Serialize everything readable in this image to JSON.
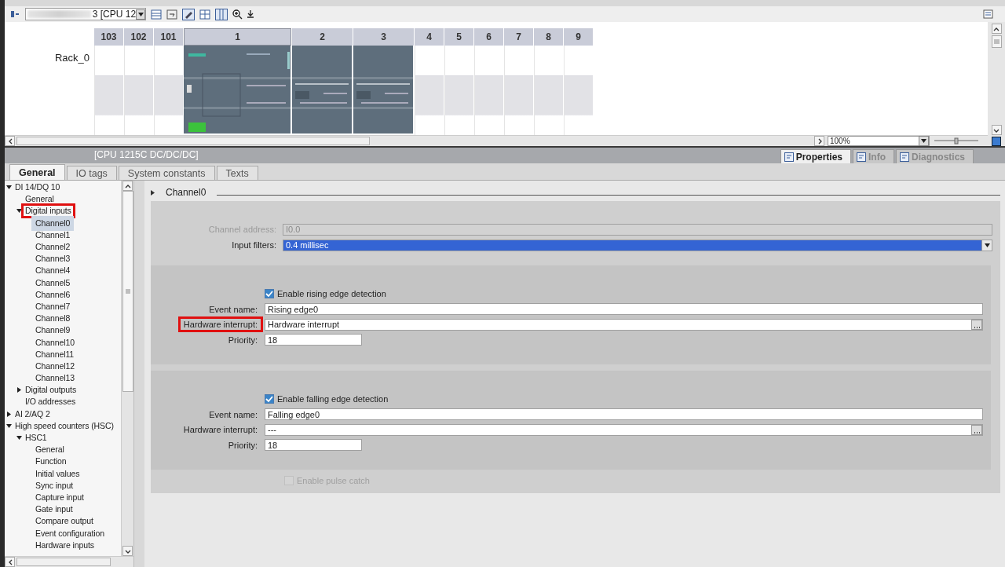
{
  "toolbar": {
    "device_dropdown": "3 [CPU 12",
    "zoom": "100%"
  },
  "rack": {
    "label": "Rack_0",
    "slots": [
      {
        "label": "103",
        "kind": "empty"
      },
      {
        "label": "102",
        "kind": "empty"
      },
      {
        "label": "101",
        "kind": "empty"
      },
      {
        "label": "1",
        "kind": "cpu"
      },
      {
        "label": "2",
        "kind": "module"
      },
      {
        "label": "3",
        "kind": "module"
      },
      {
        "label": "4",
        "kind": "empty"
      },
      {
        "label": "5",
        "kind": "empty"
      },
      {
        "label": "6",
        "kind": "empty"
      },
      {
        "label": "7",
        "kind": "empty"
      },
      {
        "label": "8",
        "kind": "empty"
      },
      {
        "label": "9",
        "kind": "empty"
      }
    ]
  },
  "properties_header": {
    "title": "[CPU 1215C DC/DC/DC]",
    "tabs": [
      {
        "label": "Properties",
        "selected": true
      },
      {
        "label": "Info",
        "selected": false
      },
      {
        "label": "Diagnostics",
        "selected": false
      }
    ]
  },
  "tabs": [
    {
      "label": "General",
      "selected": true
    },
    {
      "label": "IO tags",
      "selected": false
    },
    {
      "label": "System constants",
      "selected": false
    },
    {
      "label": "Texts",
      "selected": false
    }
  ],
  "tree": [
    {
      "label": "DI 14/DQ 10",
      "selected": false,
      "highlighted": false,
      "expanded": true,
      "children": [
        {
          "label": "General",
          "selected": false,
          "highlighted": false
        },
        {
          "label": "Digital inputs",
          "selected": false,
          "highlighted": true,
          "expanded": true,
          "children": [
            {
              "label": "Channel0",
              "selected": true,
              "highlighted": false
            },
            {
              "label": "Channel1",
              "selected": false,
              "highlighted": false
            },
            {
              "label": "Channel2",
              "selected": false,
              "highlighted": false
            },
            {
              "label": "Channel3",
              "selected": false,
              "highlighted": false
            },
            {
              "label": "Channel4",
              "selected": false,
              "highlighted": false
            },
            {
              "label": "Channel5",
              "selected": false,
              "highlighted": false
            },
            {
              "label": "Channel6",
              "selected": false,
              "highlighted": false
            },
            {
              "label": "Channel7",
              "selected": false,
              "highlighted": false
            },
            {
              "label": "Channel8",
              "selected": false,
              "highlighted": false
            },
            {
              "label": "Channel9",
              "selected": false,
              "highlighted": false
            },
            {
              "label": "Channel10",
              "selected": false,
              "highlighted": false
            },
            {
              "label": "Channel11",
              "selected": false,
              "highlighted": false
            },
            {
              "label": "Channel12",
              "selected": false,
              "highlighted": false
            },
            {
              "label": "Channel13",
              "selected": false,
              "highlighted": false
            }
          ]
        },
        {
          "label": "Digital outputs",
          "selected": false,
          "highlighted": false,
          "expanded": false
        },
        {
          "label": "I/O addresses",
          "selected": false,
          "highlighted": false
        }
      ]
    },
    {
      "label": "AI 2/AQ 2",
      "selected": false,
      "highlighted": false,
      "expanded": false
    },
    {
      "label": "High speed counters (HSC)",
      "selected": false,
      "highlighted": false,
      "expanded": true,
      "children": [
        {
          "label": "HSC1",
          "selected": false,
          "highlighted": false,
          "expanded": true,
          "children": [
            {
              "label": "General",
              "selected": false,
              "highlighted": false
            },
            {
              "label": "Function",
              "selected": false,
              "highlighted": false
            },
            {
              "label": "Initial values",
              "selected": false,
              "highlighted": false
            },
            {
              "label": "Sync input",
              "selected": false,
              "highlighted": false
            },
            {
              "label": "Capture input",
              "selected": false,
              "highlighted": false
            },
            {
              "label": "Gate input",
              "selected": false,
              "highlighted": false
            },
            {
              "label": "Compare output",
              "selected": false,
              "highlighted": false
            },
            {
              "label": "Event configuration",
              "selected": false,
              "highlighted": false
            },
            {
              "label": "Hardware inputs",
              "selected": false,
              "highlighted": false
            }
          ]
        }
      ]
    }
  ],
  "form": {
    "heading": "Channel0",
    "channel_address": {
      "label": "Channel address:",
      "value": "I0.0",
      "disabled": true
    },
    "input_filters": {
      "label": "Input filters:",
      "value": "0.4 millisec"
    },
    "groups": [
      {
        "checkbox": {
          "label": "Enable rising edge detection",
          "checked": true
        },
        "fields": [
          {
            "label": "Event name:",
            "value": "Rising edge0",
            "kind": "text",
            "highlighted": false
          },
          {
            "label": "Hardware interrupt:",
            "value": "Hardware interrupt",
            "kind": "browse",
            "highlighted": true
          },
          {
            "label": "Priority:",
            "value": "18",
            "kind": "short",
            "highlighted": false
          }
        ]
      },
      {
        "checkbox": {
          "label": "Enable falling edge detection",
          "checked": true
        },
        "fields": [
          {
            "label": "Event name:",
            "value": "Falling edge0",
            "kind": "text",
            "highlighted": false
          },
          {
            "label": "Hardware interrupt:",
            "value": "---",
            "kind": "browse",
            "highlighted": false
          },
          {
            "label": "Priority:",
            "value": "18",
            "kind": "short",
            "highlighted": false
          }
        ]
      }
    ],
    "pulse_catch": {
      "label": "Enable pulse catch",
      "checked": false,
      "disabled": true
    }
  }
}
